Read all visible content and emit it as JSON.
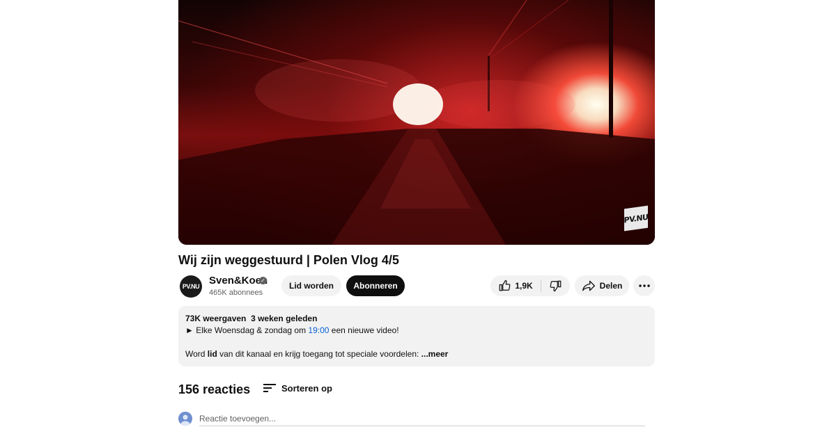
{
  "video": {
    "watermark": "PV.NU"
  },
  "title": "Wij zijn weggestuurd | Polen Vlog 4/5",
  "channel": {
    "avatar_text": "PV.NU",
    "name": "Sven&Koen",
    "subscribers": "465K abonnees",
    "verified_icon": "check-circle"
  },
  "actions": {
    "join_label": "Lid worden",
    "subscribe_label": "Abonneren",
    "likes": "1,9K",
    "share_label": "Delen",
    "more_icon": "ellipsis-horizontal"
  },
  "description": {
    "views": "73K weergaven",
    "date": "3 weken geleden",
    "line1_prefix": "► Elke Woensdag & zondag om ",
    "line1_time": "19:00",
    "line1_suffix": " een nieuwe video!",
    "line2_prefix": "Word ",
    "line2_bold": "lid",
    "line2_suffix": " van dit kanaal en krijg toegang tot speciale voordelen:",
    "more_label": " ...meer"
  },
  "comments": {
    "count_label": "156 reacties",
    "sort_label": "Sorteren op",
    "input_placeholder": "Reactie toevoegen..."
  },
  "colors": {
    "accent_link": "#065fd4",
    "subscribe_bg": "#0f0f0f",
    "pill_bg": "#f2f2f2"
  }
}
